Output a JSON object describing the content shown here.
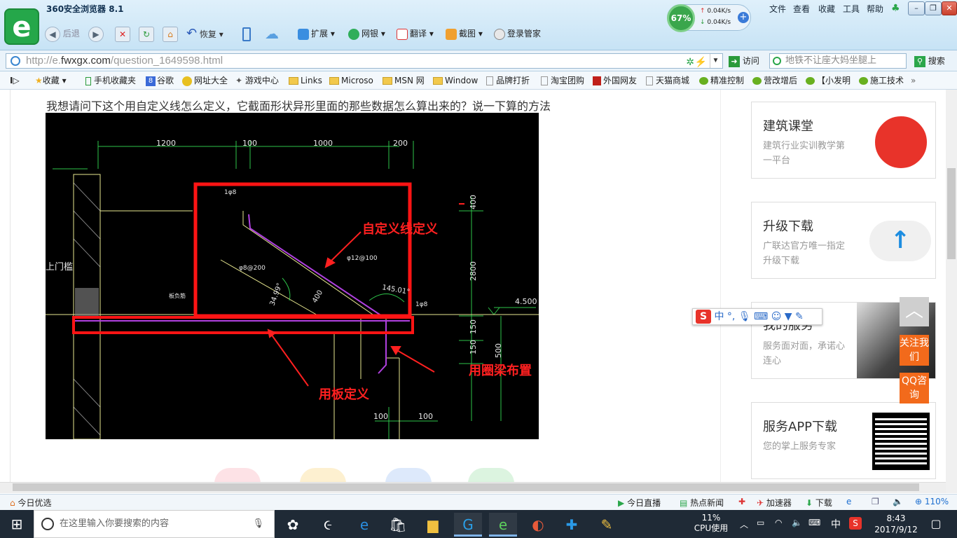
{
  "window": {
    "app_title": "360安全浏览器 8.1",
    "menu": [
      "文件",
      "查看",
      "收藏",
      "工具",
      "帮助"
    ],
    "logo_letter": "e"
  },
  "nav": {
    "back": "后退",
    "restore": "恢复",
    "extensions": "扩展",
    "bank": "网银",
    "translate": "翻译",
    "screenshot": "截图",
    "login_manager": "登录管家"
  },
  "speed_widget": {
    "percent": "67%",
    "up": "0.04K/s",
    "down": "0.04K/s"
  },
  "address_bar": {
    "url_prefix": "http://e.",
    "url_host": "fwxgx.com",
    "url_path": "/question_1649598.html",
    "visit": "访问",
    "search_placeholder": "地铁不让座大妈坐腿上",
    "search_button": "搜索"
  },
  "bookmarks": [
    {
      "label": "收藏"
    },
    {
      "label": "手机收藏夹"
    },
    {
      "label": "谷歌"
    },
    {
      "label": "网址大全"
    },
    {
      "label": "游戏中心"
    },
    {
      "label": "Links"
    },
    {
      "label": "Microso"
    },
    {
      "label": "MSN 网"
    },
    {
      "label": "Window"
    },
    {
      "label": "品牌打折"
    },
    {
      "label": "淘宝团购"
    },
    {
      "label": "外国网友"
    },
    {
      "label": "天猫商城"
    },
    {
      "label": "精准控制"
    },
    {
      "label": "营改增后"
    },
    {
      "label": "【小发明"
    },
    {
      "label": "施工技术"
    }
  ],
  "page": {
    "question": "我想请问下这个用自定义线怎么定义，它截面形状异形里面的那些数据怎么算出来的？说一下算的方法"
  },
  "drawing": {
    "dims_top": [
      "1200",
      "100",
      "1000",
      "200"
    ],
    "dims_bottom": [
      "100",
      "100"
    ],
    "dims_right": [
      "400",
      "2800",
      "150",
      "150",
      "500",
      "4.500"
    ],
    "rebar_labels": [
      "1φ8",
      "φ8@200",
      "φ12@100",
      "1φ8",
      "34.99°",
      "145.01°",
      "400",
      "板负筋",
      "上门槛"
    ],
    "annotation_custom_line": "自定义线定义",
    "annotation_slab": "用板定义",
    "annotation_ring_beam": "用圈梁布置"
  },
  "sidebar": {
    "cards": [
      {
        "title": "建筑课堂",
        "subtitle": "建筑行业实训教学第一平台"
      },
      {
        "title": "升级下载",
        "subtitle": "广联达官方唯一指定升级下载"
      },
      {
        "title": "我的服务",
        "subtitle": "服务面对面，承诺心连心"
      },
      {
        "title": "服务APP下载",
        "subtitle": "您的掌上服务专家"
      }
    ],
    "follow_us": "关注我们",
    "qq_consult": "QQ咨询"
  },
  "ime_bar": {
    "label": "中"
  },
  "status_bar": {
    "today_pick": "今日优选",
    "live": "今日直播",
    "hot_news": "热点新闻",
    "accelerator": "加速器",
    "download": "下载",
    "zoom": "110%"
  },
  "taskbar": {
    "search_placeholder": "在这里输入你要搜索的内容",
    "cpu_percent": "11%",
    "cpu_label": "CPU使用",
    "ime": "中",
    "time": "8:43",
    "date": "2017/9/12"
  },
  "colors": {
    "accent": "#25a74a",
    "annotation": "#ff2020",
    "orange": "#f26a1b"
  }
}
